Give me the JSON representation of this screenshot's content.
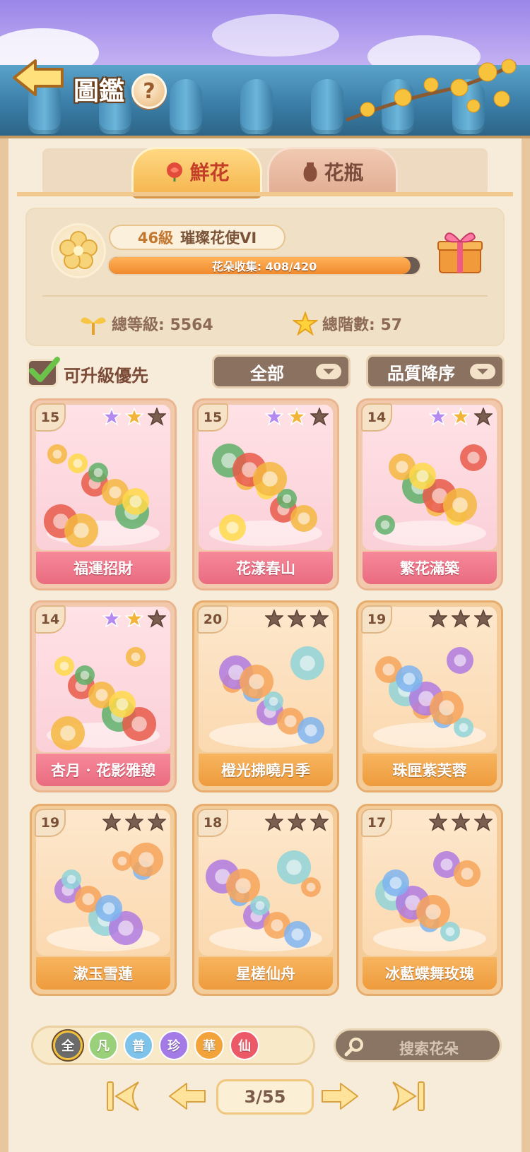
{
  "header": {
    "title": "圖鑑",
    "help_label": "?"
  },
  "tabs": [
    {
      "label": "鮮花",
      "active": true
    },
    {
      "label": "花瓶",
      "active": false
    }
  ],
  "level_panel": {
    "level": "46級",
    "rank_title": "璀璨花使VI",
    "progress_text": "花朵收集: 408/420",
    "progress_fraction": 0.9714,
    "total_level": "總等級: 5564",
    "total_tier": "總階數: 57"
  },
  "filters": {
    "upgradable_first_label": "可升級優先",
    "upgradable_first_checked": true,
    "category_value": "全部",
    "sort_value": "品質降序"
  },
  "cards": [
    {
      "name": "福運招財",
      "level": "15",
      "stars": [
        2,
        1,
        0
      ],
      "theme": "pink"
    },
    {
      "name": "花漾春山",
      "level": "15",
      "stars": [
        2,
        1,
        0
      ],
      "theme": "pink"
    },
    {
      "name": "繁花滿築",
      "level": "14",
      "stars": [
        2,
        1,
        0
      ],
      "theme": "pink"
    },
    {
      "name": "杏月 · 花影雅憩",
      "level": "14",
      "stars": [
        2,
        1,
        0
      ],
      "theme": "pink"
    },
    {
      "name": "橙光拂曉月季",
      "level": "20",
      "stars": [
        0,
        0,
        0
      ],
      "theme": "orange"
    },
    {
      "name": "珠匣紫芙蓉",
      "level": "19",
      "stars": [
        0,
        0,
        0
      ],
      "theme": "orange"
    },
    {
      "name": "漱玉雪蓮",
      "level": "19",
      "stars": [
        0,
        0,
        0
      ],
      "theme": "orange"
    },
    {
      "name": "星槎仙舟",
      "level": "18",
      "stars": [
        0,
        0,
        0
      ],
      "theme": "orange"
    },
    {
      "name": "冰藍蝶舞玫瑰",
      "level": "17",
      "stars": [
        0,
        0,
        0
      ],
      "theme": "orange"
    }
  ],
  "rarity_filters": [
    {
      "label": "全",
      "color": "#6b6b6b",
      "selected": true
    },
    {
      "label": "凡",
      "color": "#9bd07a",
      "selected": false
    },
    {
      "label": "普",
      "color": "#7ec3ea",
      "selected": false
    },
    {
      "label": "珍",
      "color": "#a47ae6",
      "selected": false
    },
    {
      "label": "華",
      "color": "#f2a33a",
      "selected": false
    },
    {
      "label": "仙",
      "color": "#ec5a68",
      "selected": false
    }
  ],
  "search": {
    "placeholder": "搜索花朵"
  },
  "pagination": {
    "current_page": "3/55"
  },
  "colors": {
    "star_purple": "#b58af0",
    "star_gold": "#f3b43a",
    "star_empty": "#7a5e50"
  }
}
